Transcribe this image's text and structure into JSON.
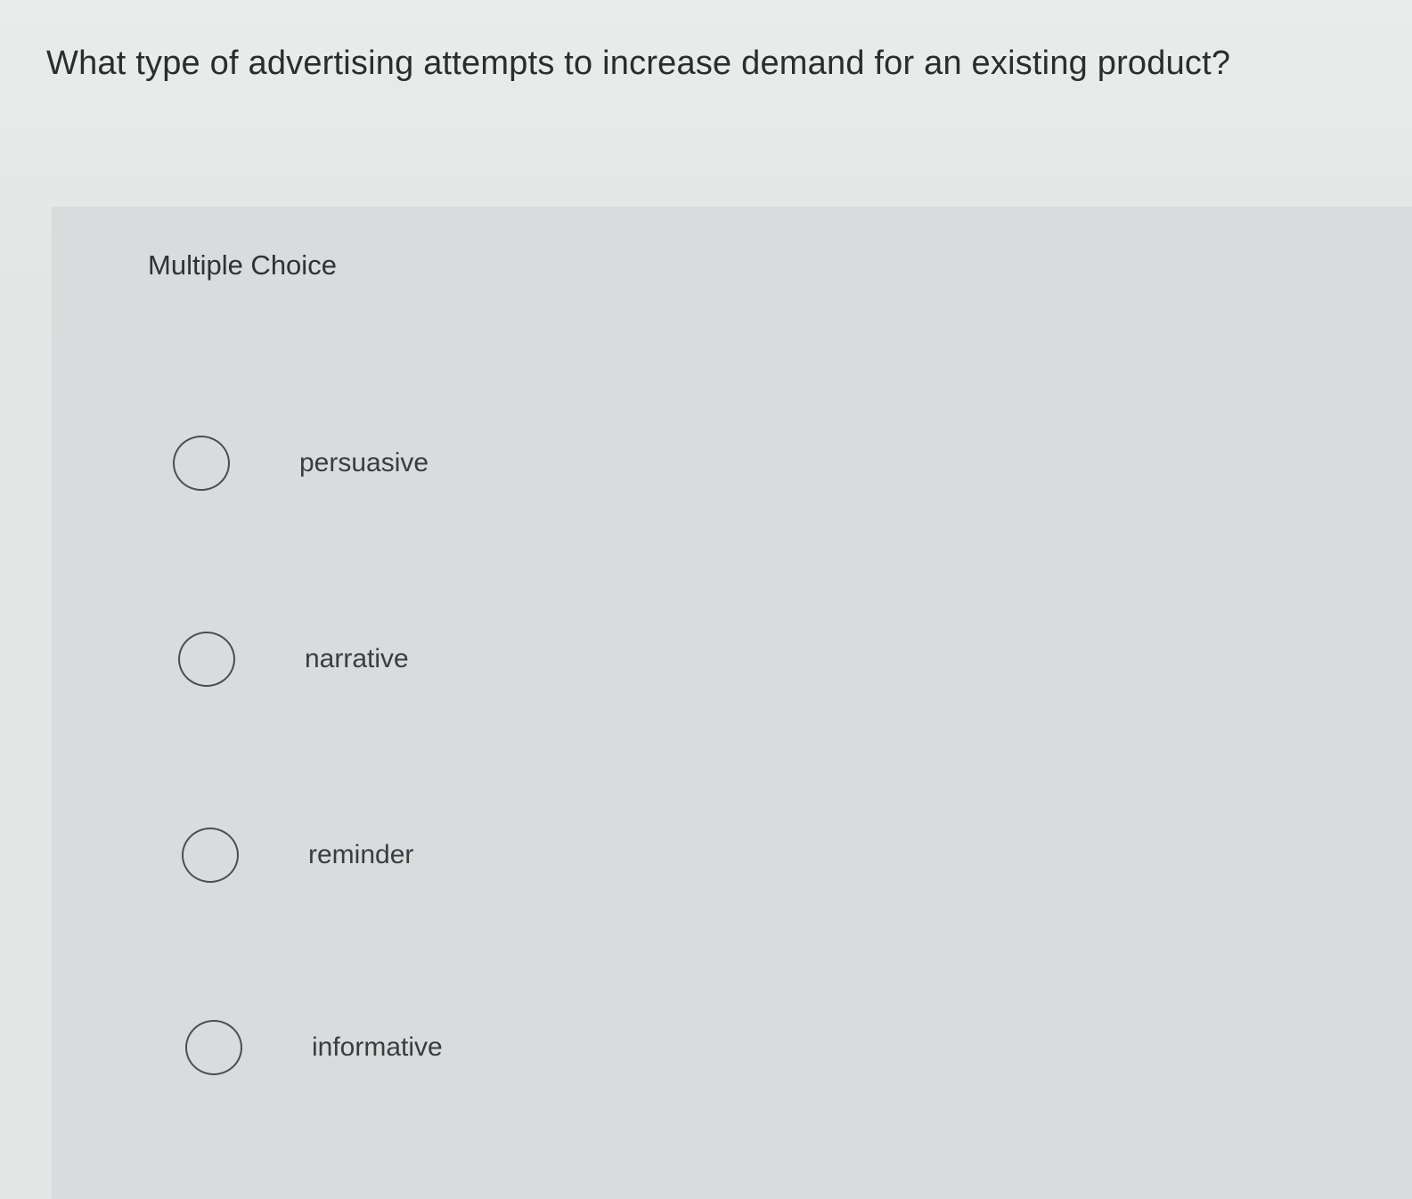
{
  "question": {
    "text": "What type of advertising attempts to increase demand for an existing product?"
  },
  "quiz": {
    "type_label": "Multiple Choice",
    "options": [
      {
        "label": "persuasive",
        "selected": false
      },
      {
        "label": "narrative",
        "selected": false
      },
      {
        "label": "reminder",
        "selected": false
      },
      {
        "label": "informative",
        "selected": false
      }
    ]
  },
  "colors": {
    "background": "#e3e5e5",
    "panel": "#d9dcdc",
    "text": "#2f3233",
    "radio_border": "#4a4e4f"
  }
}
